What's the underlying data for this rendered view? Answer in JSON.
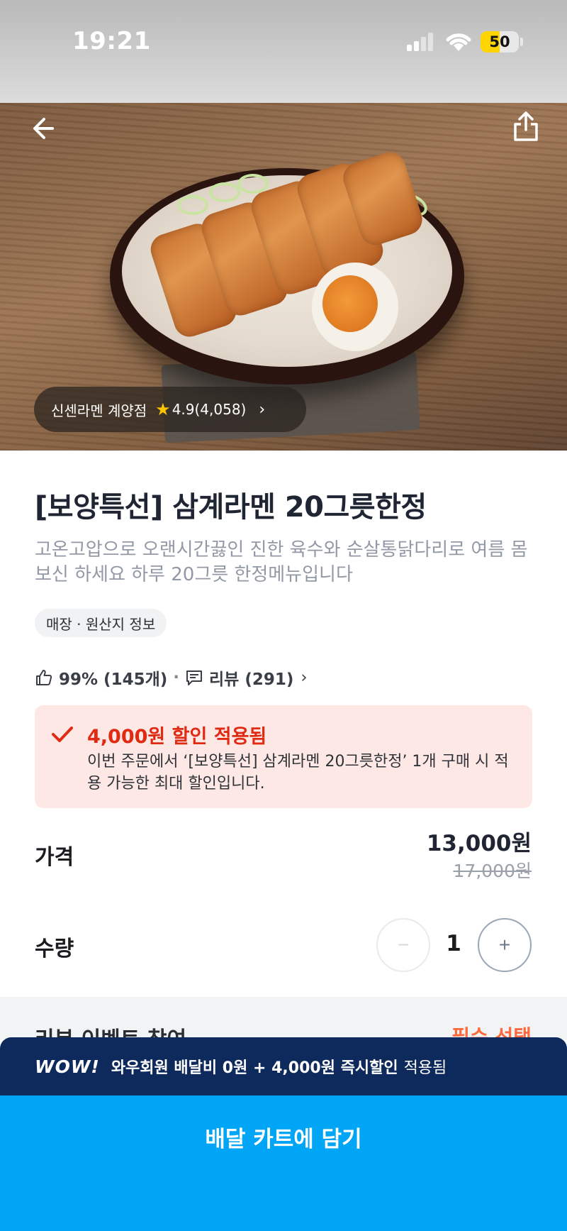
{
  "status_bar": {
    "time": "19:21",
    "battery": "50"
  },
  "hero": {
    "store_name": "신센라멘 계양점",
    "rating": "4.9(4,058)",
    "back_icon": "arrow-left-icon",
    "share_icon": "share-icon"
  },
  "product": {
    "title": "[보양특선] 삼계라멘 20그릇한정",
    "description": "고온고압으로 오랜시간끓인 진한 육수와 순살통닭다리로 여름 몸보신 하세요 하루 20그릇 한정메뉴입니다",
    "origin_chip": "매장 · 원산지 정보"
  },
  "stats": {
    "like_text": "99% (145개)",
    "separator": "·",
    "review_text": "리뷰 (291)"
  },
  "discount": {
    "headline": "4,000원 할인 적용됨",
    "body": "이번 주문에서 ‘[보양특선] 삼계라멘 20그릇한정’ 1개 구매 시 적용 가능한 최대 할인입니다.",
    "accent_color": "#e12a12"
  },
  "price": {
    "label": "가격",
    "current": "13,000원",
    "original": "17,000원"
  },
  "quantity": {
    "label": "수량",
    "value": "1",
    "minus": "−",
    "plus": "+"
  },
  "peek": {
    "left": "리뷰 이벤트 참여",
    "right": "필수 선택"
  },
  "wow": {
    "logo": "WOW!",
    "text": "와우회원 배달비 0원 + 4,000원 즉시할인",
    "suffix": "적용됨"
  },
  "cart_button": {
    "label": "배달 카트에 담기",
    "color": "#00a6f5"
  }
}
